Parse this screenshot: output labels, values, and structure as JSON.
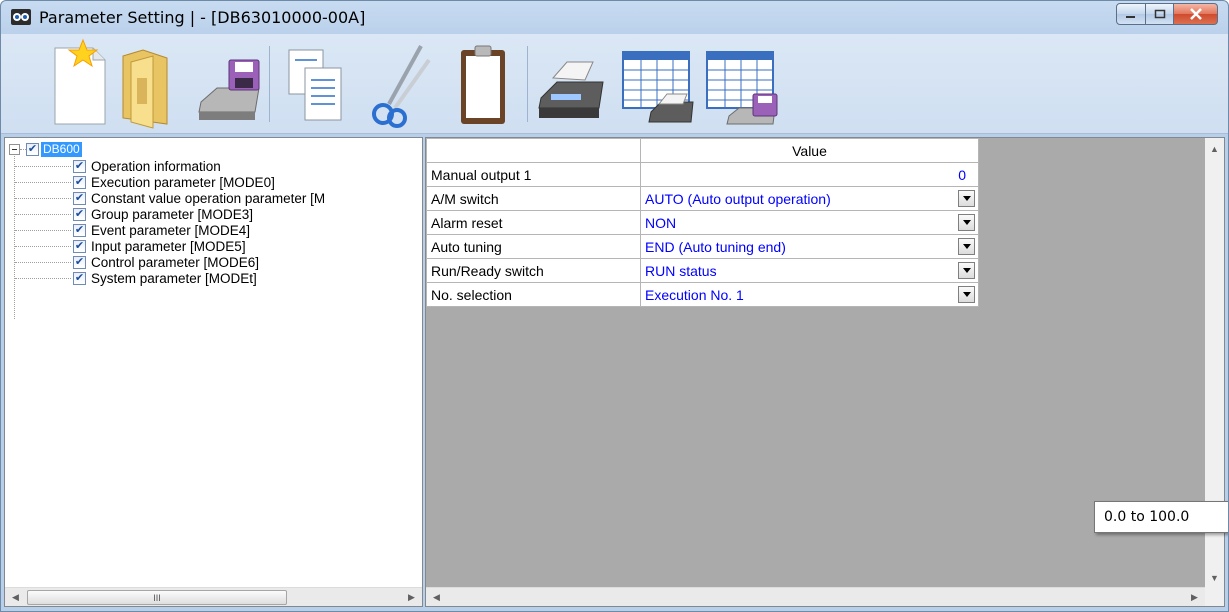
{
  "window": {
    "title": "Parameter Setting |  - [DB63010000-00A]",
    "icon": "app-logo-icon"
  },
  "toolbar": {
    "buttons": [
      {
        "name": "new-file-icon"
      },
      {
        "name": "open-folder-icon"
      },
      {
        "name": "save-disk-icon"
      },
      {
        "name": "copy-icon"
      },
      {
        "name": "cut-scissors-icon"
      },
      {
        "name": "paste-clipboard-icon"
      },
      {
        "name": "print-icon"
      },
      {
        "name": "print-table-icon"
      },
      {
        "name": "save-table-icon"
      }
    ]
  },
  "tree": {
    "root": {
      "label": "DB600",
      "checked": true
    },
    "items": [
      {
        "label": "Operation information",
        "checked": true
      },
      {
        "label": "Execution parameter [MODE0]",
        "checked": true
      },
      {
        "label": "Constant value operation parameter [M",
        "checked": true
      },
      {
        "label": "Group parameter [MODE3]",
        "checked": true
      },
      {
        "label": "Event parameter [MODE4]",
        "checked": true
      },
      {
        "label": "Input parameter [MODE5]",
        "checked": true
      },
      {
        "label": "Control parameter [MODE6]",
        "checked": true
      },
      {
        "label": "System parameter [MODEt]",
        "checked": true
      }
    ],
    "hscroll_thumb_grip": "III"
  },
  "grid": {
    "header": {
      "value": "Value"
    },
    "rows": [
      {
        "name": "Manual output 1",
        "value": "0",
        "type": "number"
      },
      {
        "name": "A/M switch",
        "value": "AUTO (Auto output operation)",
        "type": "select"
      },
      {
        "name": "Alarm reset",
        "value": "NON",
        "type": "select"
      },
      {
        "name": "Auto tuning",
        "value": "END (Auto tuning end)",
        "type": "select"
      },
      {
        "name": "Run/Ready switch",
        "value": "RUN status",
        "type": "select"
      },
      {
        "name": "No. selection",
        "value": "Execution No. 1",
        "type": "select"
      }
    ]
  },
  "tooltip": {
    "text": "0.0 to 100.0"
  },
  "colors": {
    "value_text": "#0000ff",
    "selection": "#3399ff",
    "grid_background": "#aaaaaa"
  }
}
